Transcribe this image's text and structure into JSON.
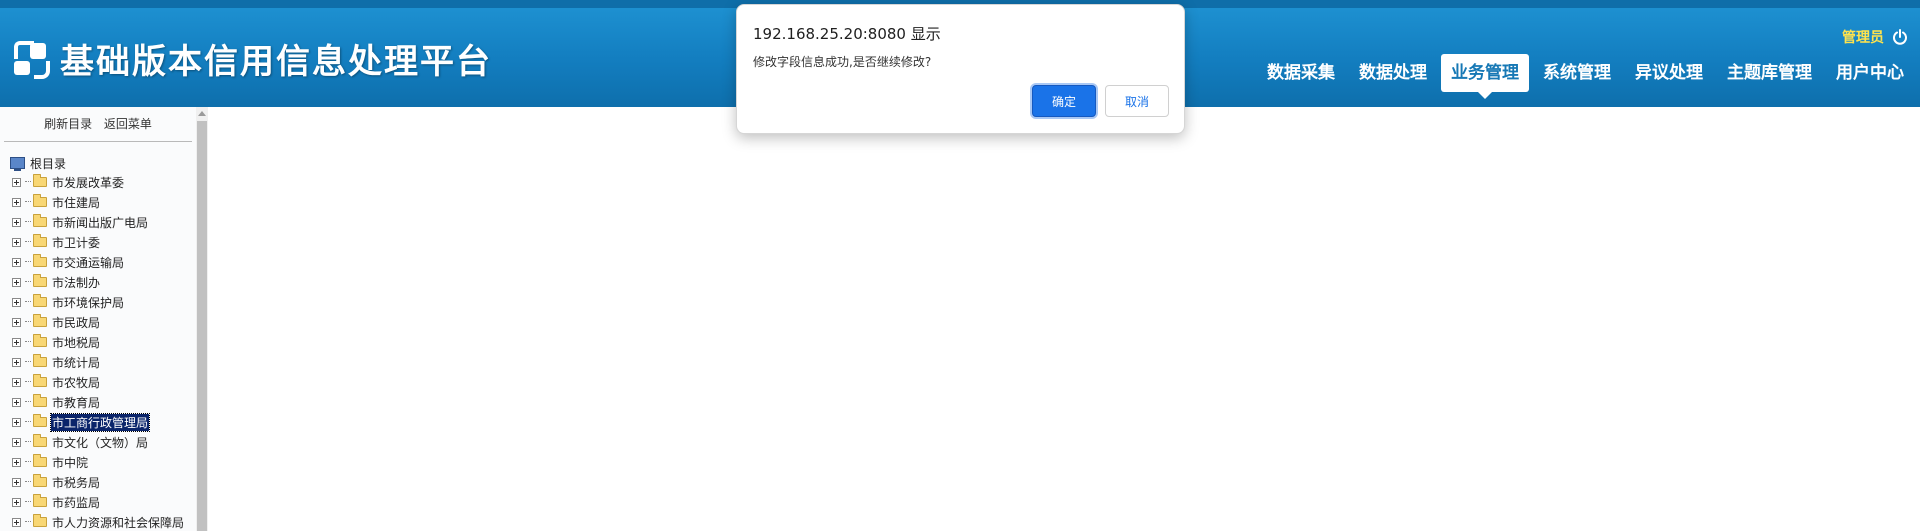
{
  "header": {
    "title": "基础版本信用信息处理平台",
    "user": "管理员",
    "nav": [
      {
        "label": "数据采集",
        "active": false
      },
      {
        "label": "数据处理",
        "active": false
      },
      {
        "label": "业务管理",
        "active": true
      },
      {
        "label": "系统管理",
        "active": false
      },
      {
        "label": "异议处理",
        "active": false
      },
      {
        "label": "主题库管理",
        "active": false
      },
      {
        "label": "用户中心",
        "active": false
      }
    ],
    "colors": {
      "bar": "#1583c6",
      "user_text": "#ffe34d"
    }
  },
  "sidebar": {
    "refresh_label": "刷新目录",
    "back_label": "返回菜单",
    "root_label": "根目录",
    "nodes": [
      "市发展改革委",
      "市住建局",
      "市新闻出版广电局",
      "市卫计委",
      "市交通运输局",
      "市法制办",
      "市环境保护局",
      "市民政局",
      "市地税局",
      "市统计局",
      "市农牧局",
      "市教育局",
      "市工商行政管理局",
      "市文化（文物）局",
      "市中院",
      "市税务局",
      "市药监局",
      "市人力资源和社会保障局"
    ],
    "selected_index": 12
  },
  "dialog": {
    "title": "192.168.25.20:8080 显示",
    "message": "修改字段信息成功,是否继续修改?",
    "ok_label": "确定",
    "cancel_label": "取消"
  }
}
